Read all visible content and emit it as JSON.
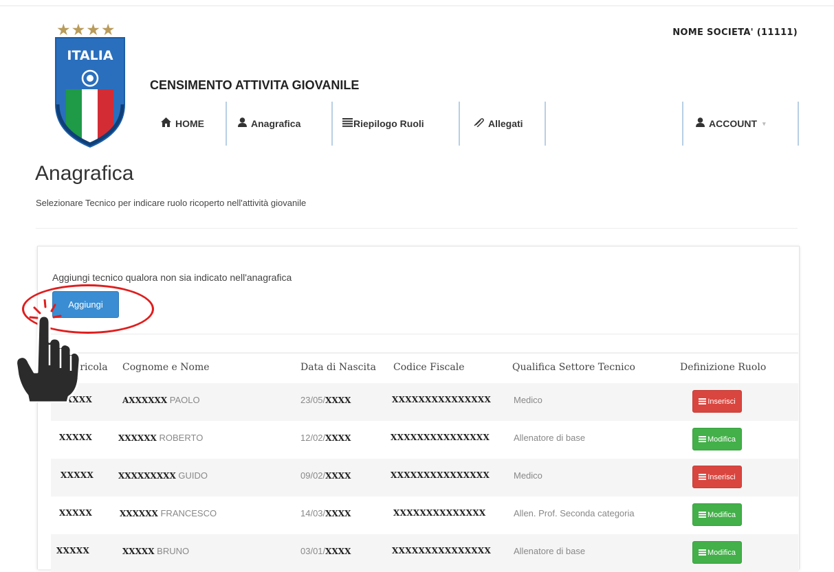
{
  "header": {
    "logo_text": "ITALIA",
    "stars": "★★★★",
    "societa": "NOME SOCIETA' (11111)",
    "app_title": "CENSIMENTO ATTIVITA GIOVANILE"
  },
  "nav": {
    "items": [
      {
        "label": "HOME",
        "icon": "home-icon"
      },
      {
        "label": "Anagrafica",
        "icon": "user-icon"
      },
      {
        "label": "Riepilogo Ruoli",
        "icon": "list-icon"
      },
      {
        "label": "Allegati",
        "icon": "paperclip-icon"
      }
    ],
    "account": {
      "label": "ACCOUNT",
      "icon": "user-icon"
    }
  },
  "page": {
    "title": "Anagrafica",
    "subtitle": "Selezionare Tecnico per indicare ruolo ricoperto nell'attività giovanile"
  },
  "panel": {
    "add_text": "Aggiungi tecnico qualora non sia indicato nell'anagrafica",
    "add_button": "Aggiungi"
  },
  "table": {
    "headers": [
      "Matricola",
      "Cognome e Nome",
      "Data di Nascita",
      "Codice Fiscale",
      "Qualifica Settore Tecnico",
      "Definizione Ruolo"
    ],
    "rows": [
      {
        "matricola": "XXXXX",
        "cognome": "AXXXXXX",
        "nome": " PAOLO",
        "data_pre": "23/05/",
        "data_year": "XXXX",
        "codice": "XXXXXXXXXXXXXXX",
        "qualifica": "Medico",
        "action": "Inserisci",
        "action_color": "#d9463f"
      },
      {
        "matricola": "XXXXX",
        "cognome": "XXXXXX",
        "nome": " ROBERTO",
        "data_pre": "12/02/",
        "data_year": "XXXX",
        "codice": "XXXXXXXXXXXXXXX",
        "qualifica": "Allenatore di base",
        "action": "Modifica",
        "action_color": "#43b049"
      },
      {
        "matricola": "XXXXX",
        "cognome": "XXXXXXXXX",
        "nome": " GUIDO",
        "data_pre": "09/02/",
        "data_year": "XXXX",
        "codice": "XXXXXXXXXXXXXXX",
        "qualifica": "Medico",
        "action": "Inserisci",
        "action_color": "#d9463f"
      },
      {
        "matricola": "XXXXX",
        "cognome": "XXXXXX",
        "nome": " FRANCESCO",
        "data_pre": "14/03/",
        "data_year": "XXXX",
        "codice": "XXXXXXXXXXXXXX",
        "qualifica": "Allen. Prof. Seconda categoria",
        "action": "Modifica",
        "action_color": "#43b049"
      },
      {
        "matricola": "XXXXX",
        "cognome": "XXXXX",
        "nome": " BRUNO",
        "data_pre": "03/01/",
        "data_year": "XXXX",
        "codice": "XXXXXXXXXXXXXXX",
        "qualifica": "Allenatore di base",
        "action": "Modifica",
        "action_color": "#43b049"
      }
    ]
  },
  "colors": {
    "primary_blue": "#3a8dd2",
    "danger_red": "#d9463f",
    "success_green": "#43b049",
    "highlight_circle": "#e01d1d"
  }
}
